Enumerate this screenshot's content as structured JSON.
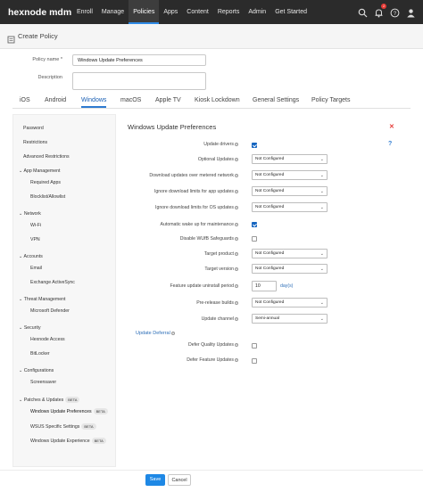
{
  "topbar": {
    "logo": "hexnode mdm",
    "nav": [
      "Enroll",
      "Manage",
      "Policies",
      "Apps",
      "Content",
      "Reports",
      "Admin",
      "Get Started"
    ],
    "active_nav": "Policies",
    "notification_count": "1"
  },
  "header": {
    "title": "Create Policy"
  },
  "form": {
    "policy_name_label": "Policy name *",
    "policy_name_value": "Windows Update Preferences",
    "description_label": "Description",
    "description_value": ""
  },
  "tabs": [
    "iOS",
    "Android",
    "Windows",
    "macOS",
    "Apple TV",
    "Kiosk Lockdown",
    "General Settings",
    "Policy Targets"
  ],
  "active_tab": "Windows",
  "sidebar": {
    "items": [
      {
        "label": "Password",
        "type": "item"
      },
      {
        "label": "Restrictions",
        "type": "item"
      },
      {
        "label": "Advanced Restrictions",
        "type": "item"
      },
      {
        "label": "App Management",
        "type": "group"
      },
      {
        "label": "Required Apps",
        "type": "sub"
      },
      {
        "label": "Blocklist/Allowlist",
        "type": "sub"
      },
      {
        "label": "Network",
        "type": "group"
      },
      {
        "label": "Wi-Fi",
        "type": "sub"
      },
      {
        "label": "VPN",
        "type": "sub"
      },
      {
        "label": "Accounts",
        "type": "group"
      },
      {
        "label": "Email",
        "type": "sub"
      },
      {
        "label": "Exchange ActiveSync",
        "type": "sub"
      },
      {
        "label": "Threat Management",
        "type": "group"
      },
      {
        "label": "Microsoft Defender",
        "type": "sub"
      },
      {
        "label": "Security",
        "type": "group"
      },
      {
        "label": "Hexnode Access",
        "type": "sub"
      },
      {
        "label": "BitLocker",
        "type": "sub"
      },
      {
        "label": "Configurations",
        "type": "group"
      },
      {
        "label": "Screensaver",
        "type": "sub"
      },
      {
        "label": "Patches & Updates",
        "type": "group",
        "badge": "BETA"
      },
      {
        "label": "Windows Update Preferences",
        "type": "sub",
        "badge": "BETA",
        "active": true
      },
      {
        "label": "WSUS Specific Settings",
        "type": "sub",
        "badge": "BETA"
      },
      {
        "label": "Windows Update Experience",
        "type": "sub",
        "badge": "BETA"
      }
    ]
  },
  "section": {
    "title": "Windows Update Preferences",
    "rows": [
      {
        "label": "Update drivers",
        "control": "checkbox",
        "checked": true
      },
      {
        "label": "Optional Updates",
        "control": "select",
        "value": "Not Configured"
      },
      {
        "label": "Download updates over metered network",
        "control": "select",
        "value": "Not Configured"
      },
      {
        "label": "Ignore download limits for app updates",
        "control": "select",
        "value": "Not Configured"
      },
      {
        "label": "Ignore download limits for OS updates",
        "control": "select",
        "value": "Not Configured"
      },
      {
        "label": "Automatic wake up for maintenance",
        "control": "checkbox",
        "checked": true
      },
      {
        "label": "Disable WUfB Safeguards",
        "control": "checkbox",
        "checked": false
      },
      {
        "label": "Target product",
        "control": "select",
        "value": "Not Configured"
      },
      {
        "label": "Target version",
        "control": "select",
        "value": "Not Configured"
      },
      {
        "label": "Feature update uninstall period",
        "control": "number",
        "value": "10",
        "unit": "day(s)"
      },
      {
        "label": "Pre-release builds",
        "control": "select",
        "value": "Not Configured"
      },
      {
        "label": "Update channel",
        "control": "select",
        "value": "Semi-annual"
      }
    ],
    "deferral_heading": "Update Deferral",
    "deferral_rows": [
      {
        "label": "Defer Quality Updates",
        "checked": false
      },
      {
        "label": "Defer Feature Updates",
        "checked": false
      }
    ]
  },
  "buttons": {
    "save": "Save",
    "cancel": "Cancel"
  },
  "colors": {
    "accent": "#1e88e5",
    "topbar": "#2b2b2b",
    "danger": "#e53935",
    "badge": "#e53935"
  }
}
